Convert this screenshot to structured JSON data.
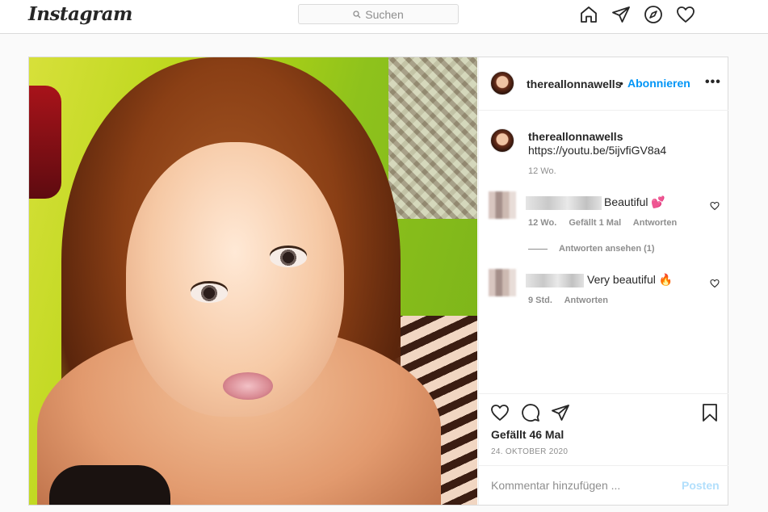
{
  "app": {
    "logo": "Instagram"
  },
  "search": {
    "placeholder": "Suchen"
  },
  "nav": {
    "icons": [
      "home-icon",
      "direct-icon",
      "explore-icon",
      "activity-heart-icon"
    ]
  },
  "post": {
    "username": "thereallonnawells",
    "dot": "•",
    "follow_label": "Abonnieren",
    "more_label": "•••",
    "caption": {
      "username": "thereallonnawells",
      "text": "https://youtu.be/5ijvfiGV8a4",
      "time": "12 Wo."
    },
    "comments": [
      {
        "text": "Beautiful 💕",
        "time": "12 Wo.",
        "likes": "Gefällt 1 Mal",
        "reply_label": "Antworten",
        "view_replies": "Antworten ansehen (1)"
      },
      {
        "text": "Very beautiful 🔥",
        "time": "9 Std.",
        "reply_label": "Antworten"
      }
    ],
    "likes_text": "Gefällt 46 Mal",
    "date": "24. OKTOBER 2020",
    "comment_placeholder": "Kommentar hinzufügen ...",
    "post_label": "Posten"
  },
  "colors": {
    "link_blue": "#0095f6",
    "disabled_blue": "#b2dffc",
    "muted": "#8e8e8e",
    "border": "#dbdbdb"
  }
}
